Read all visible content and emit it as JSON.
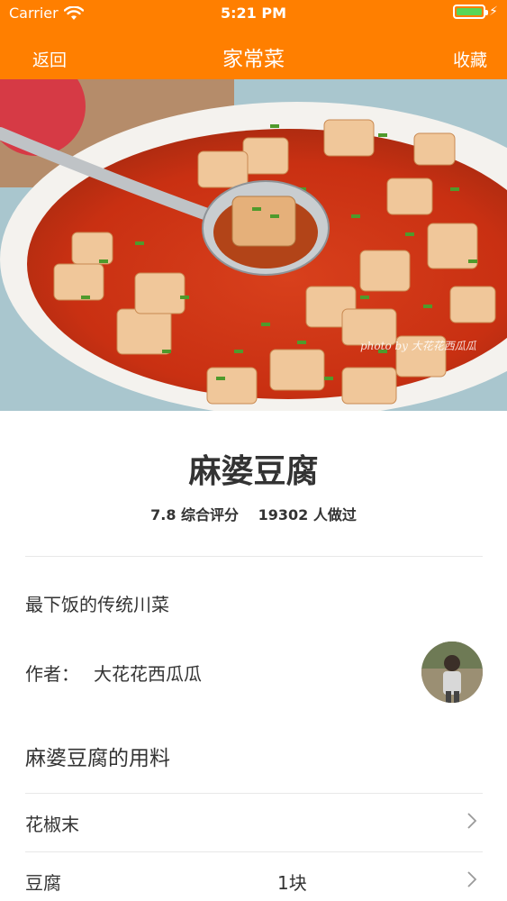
{
  "status_bar": {
    "carrier": "Carrier",
    "time": "5:21 PM",
    "wifi_icon": "wifi-icon",
    "battery_icon": "battery-icon",
    "battery_color": "#57d657"
  },
  "nav": {
    "back_label": "返回",
    "title": "家常菜",
    "favorite_label": "收藏",
    "background": "#ff7f00"
  },
  "recipe": {
    "name": "麻婆豆腐",
    "rating": "7.8",
    "rating_label": "综合评分",
    "made_count": "19302",
    "made_label": "人做过",
    "tagline": "最下饭的传统川菜",
    "author_label": "作者：",
    "author_name": "大花花西瓜瓜",
    "photo_watermark": "photo by 大花花西瓜瓜"
  },
  "ingredients_section": {
    "title": "麻婆豆腐的用料",
    "items": [
      {
        "name": "花椒末",
        "amount": ""
      },
      {
        "name": "豆腐",
        "amount": "1块"
      }
    ]
  }
}
